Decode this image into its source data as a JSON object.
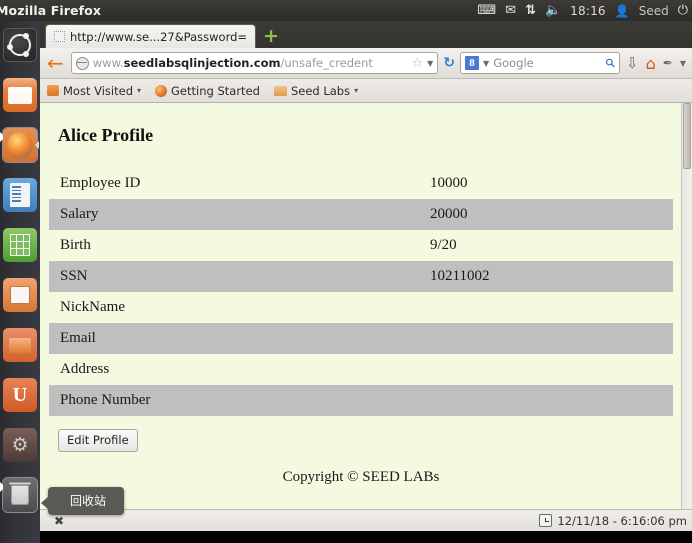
{
  "top_panel": {
    "app_title": "Mozilla Firefox",
    "indicators": [
      {
        "name": "keyboard-icon",
        "glyph": "⌨"
      },
      {
        "name": "mail-icon",
        "glyph": "✉"
      },
      {
        "name": "network-icon",
        "glyph": "⇅"
      },
      {
        "name": "volume-icon",
        "glyph": "🔊"
      }
    ],
    "time": "18:16",
    "user_icon": "👤",
    "user": "Seed",
    "power_icon": "⏻"
  },
  "launcher": {
    "items": [
      {
        "name": "dash-home",
        "label": "Ubuntu Dash"
      },
      {
        "name": "files",
        "label": "Files"
      },
      {
        "name": "firefox",
        "label": "Firefox Web Browser"
      },
      {
        "name": "writer",
        "label": "LibreOffice Writer"
      },
      {
        "name": "calc",
        "label": "LibreOffice Calc"
      },
      {
        "name": "impress",
        "label": "LibreOffice Impress"
      },
      {
        "name": "software-center",
        "label": "Ubuntu Software Center"
      },
      {
        "name": "ubuntu-one",
        "label": "U"
      },
      {
        "name": "system-settings",
        "label": "System Settings"
      },
      {
        "name": "trash",
        "label": "Trash"
      }
    ]
  },
  "tooltip": {
    "text": "回收站"
  },
  "browser": {
    "tab": {
      "title": "http://www.se...27&Password=",
      "new_tab_glyph": "+"
    },
    "back_glyph": "←",
    "url": {
      "scheme_prefix": "www.",
      "host": "seedlabsqlinjection.com",
      "path": "/unsafe_credent",
      "star_glyph": "☆",
      "caret_glyph": "▼",
      "reload_glyph": "↻"
    },
    "search": {
      "engine_badge": "8",
      "caret_glyph": "▼",
      "placeholder": "Google",
      "magnifier_glyph": "⚲"
    },
    "toolbar_icons": [
      {
        "name": "downloads-icon",
        "glyph": "⇩"
      },
      {
        "name": "home-icon",
        "glyph": "⌂"
      },
      {
        "name": "bookmark-pin-icon",
        "glyph": "✒"
      },
      {
        "name": "overflow-caret-icon",
        "glyph": "▼"
      }
    ],
    "bookmarks": [
      {
        "name": "most-visited",
        "label": "Most Visited",
        "caret": "▾"
      },
      {
        "name": "getting-started",
        "label": "Getting Started",
        "caret": ""
      },
      {
        "name": "seed-labs",
        "label": "Seed Labs",
        "caret": "▾"
      }
    ]
  },
  "page": {
    "title": "Alice Profile",
    "rows": [
      {
        "label": "Employee ID",
        "value": "10000"
      },
      {
        "label": "Salary",
        "value": "20000"
      },
      {
        "label": "Birth",
        "value": "9/20"
      },
      {
        "label": "SSN",
        "value": "10211002"
      },
      {
        "label": "NickName",
        "value": ""
      },
      {
        "label": "Email",
        "value": ""
      },
      {
        "label": "Address",
        "value": ""
      },
      {
        "label": "Phone Number",
        "value": ""
      }
    ],
    "edit_button": "Edit Profile",
    "copyright": "Copyright © SEED LABs"
  },
  "statusbar": {
    "left_glyph": "✖",
    "clock_icon": "clock-icon",
    "datetime": "12/11/18 - 6:16:06 pm"
  },
  "colors": {
    "page_bg": "#f3fadf",
    "row_alt": "#bfbfbf",
    "panel_bg": "#35332f",
    "accent_orange": "#e8731d"
  }
}
